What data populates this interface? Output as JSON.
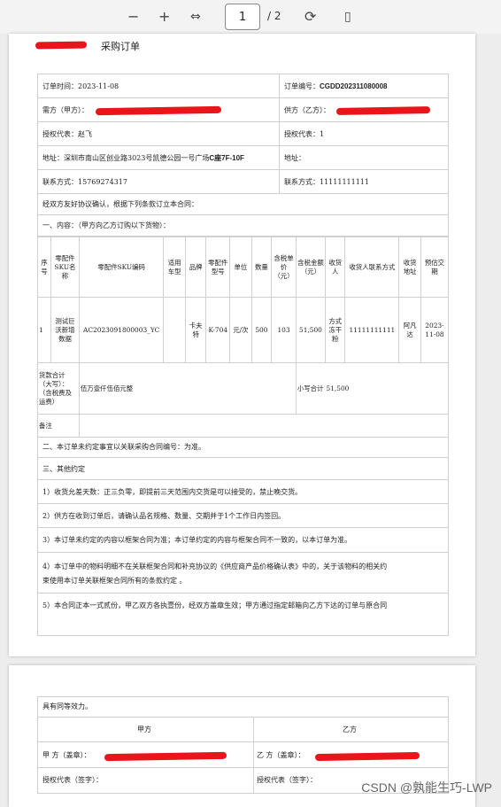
{
  "toolbar": {
    "zoom_out": "−",
    "zoom_in": "+",
    "fit_icon": "⇔",
    "page": "1",
    "total": "/ 2",
    "rotate": "⟳",
    "view": "▯"
  },
  "doc": {
    "title": "采购订单",
    "order_date": "订单时间：2023-11-08",
    "order_no_label": "订单编号：",
    "order_no": "CGDD202311080008",
    "buyer": "需方（甲方）：",
    "supplier": "供方（乙方）：",
    "rep_a": "授权代表：赵飞",
    "rep_b": "授权代表：1",
    "addr_a": "地址：深圳市南山区创业路3023号凯德公园一号广场",
    "addr_a_b": "C座7F-10F",
    "addr_b": "地址：",
    "contact_a": "联系方式：15769274317",
    "contact_b": "联系方式：11111111111",
    "intro": "经双方友好协议确认，根据下列条款订立本合同：",
    "sec1": "一、内容：（甲方向乙方订购以下货物）：",
    "headers": [
      "序号",
      "零配件SKU名称",
      "零配件SKU编码",
      "适用车型",
      "品牌",
      "零配件型号",
      "单位",
      "数量",
      "含税单价（元）",
      "含税金额（元）",
      "收货人",
      "收货人联系方式",
      "收货地址",
      "预估交期"
    ],
    "row": [
      "1",
      "测试巨沃新增数据",
      "AC2023091800003_YC",
      "",
      "卡夫特",
      "K-704",
      "元/次",
      "500",
      "103",
      "51,500",
      "方式冻干粉",
      "11111111111",
      "阿凡达",
      "2023-11-08"
    ],
    "total_label": "货款合计（大写）：（含税费及运费）",
    "total_cn": "伍万壹仟伍佰元整",
    "subtotal_label": "小写合计",
    "subtotal": "51,500",
    "note": "备注",
    "sec2": "二、本订单未约定事宜以关联采购合同编号：为准。",
    "sec3": "三、其他约定",
    "c1": "1）收货允差天数：正三负零，即提前三天范围内交货是可以接受的，禁止晚交货。",
    "c2": "2）供方在收到订单后，请确认品名规格、数量、交期并于1个工作日内签回。",
    "c3": "3）本订单未约定的内容以框架合同为准；本订单约定的内容与框架合同不一致的，以本订单为准。",
    "c4a": "4）本订单中的物料明细不在关联框架合同和补充协议的《供应商产品价格确认表》中的，关于该物料的相关约",
    "c4b": "束使用本订单关联框架合同所有的条款约定 。",
    "c5": "5）本合同正本一式贰份，甲乙双方各执壹份，经双方盖章生效；甲方通过指定邮箱向乙方下达的订单与原合同",
    "p2_line": "具有同等效力。",
    "party_a": "甲方",
    "party_b": "乙方",
    "seal_a": "甲 方（盖章）：",
    "seal_b": "乙 方（盖章）：",
    "sign_a": "授权代表（签字）：",
    "sign_b": "授权代表（签字）："
  },
  "watermark": "CSDN @孰能生巧-LWP",
  "colors": {
    "redaction": "#e8151b",
    "toolbar_bg": "#f3f3f3",
    "page_bg": "#ededed"
  }
}
